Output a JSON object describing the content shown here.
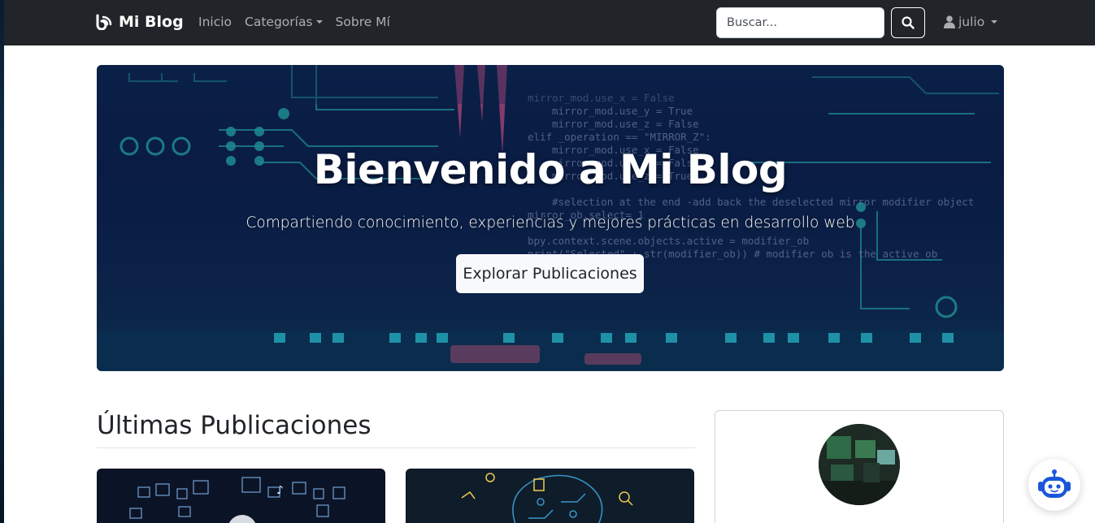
{
  "navbar": {
    "brand": "Mi Blog",
    "links": [
      {
        "label": "Inicio"
      },
      {
        "label": "Categorías",
        "dropdown": true
      },
      {
        "label": "Sobre Mí"
      }
    ],
    "search": {
      "placeholder": "Buscar...",
      "value": ""
    },
    "user": {
      "name": "julio"
    }
  },
  "hero": {
    "title": "Bienvenido a Mi Blog",
    "subtitle": "Compartiendo conocimiento, experiencias y mejores prácticas en desarrollo web",
    "button_label": "Explorar Publicaciones"
  },
  "main": {
    "section_title": "Últimas Publicaciones"
  },
  "icons": {
    "brand": "blog-logo-icon",
    "search": "search-icon",
    "user": "user-icon",
    "chatbot": "robot-icon"
  },
  "colors": {
    "navbar_bg": "#212529",
    "accent_blue": "#1a56db"
  }
}
